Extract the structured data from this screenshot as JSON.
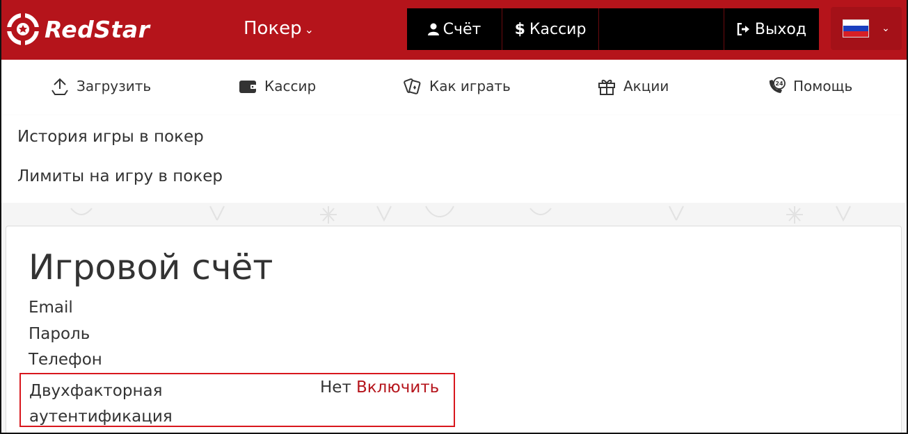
{
  "brand": {
    "name": "RedStar",
    "primary_color": "#b5141b"
  },
  "header": {
    "poker_menu": "Покер",
    "nav": {
      "account": "Счёт",
      "cashier": "Кассир",
      "logout": "Выход"
    },
    "language": "russian-flag"
  },
  "subnav": {
    "items": [
      {
        "label": "Загрузить",
        "icon": "download-icon"
      },
      {
        "label": "Кассир",
        "icon": "wallet-icon"
      },
      {
        "label": "Как играть",
        "icon": "cards-icon"
      },
      {
        "label": "Акции",
        "icon": "gift-icon"
      },
      {
        "label": "Помощь",
        "icon": "support-24-icon"
      }
    ]
  },
  "dropdown": {
    "links": [
      "История игры в покер",
      "Лимиты на игру в покер"
    ]
  },
  "account": {
    "title": "Игровой счёт",
    "fields": [
      "Email",
      "Пароль",
      "Телефон"
    ],
    "twofa": {
      "label": "Двухфакторная аутентификация",
      "status": "Нет",
      "action": "Включить"
    }
  }
}
